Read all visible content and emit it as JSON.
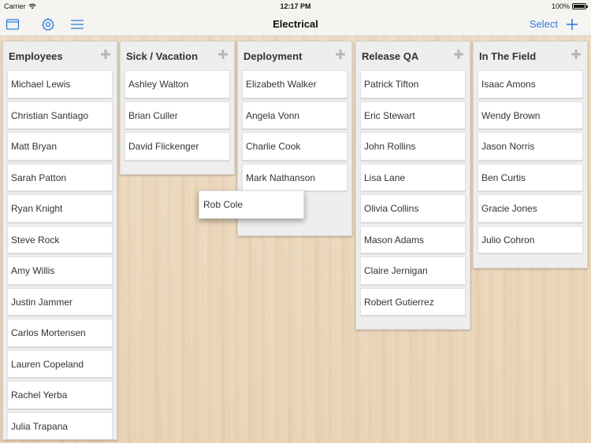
{
  "status_bar": {
    "carrier": "Carrier",
    "time": "12:17 PM",
    "battery": "100%"
  },
  "nav": {
    "title": "Electrical",
    "select_label": "Select",
    "left_icons": [
      "board-icon",
      "gear-icon",
      "list-icon"
    ],
    "right_icon": "plus-icon",
    "accent_color": "#2f7de1"
  },
  "columns": [
    {
      "title": "Employees",
      "cards": [
        "Michael Lewis",
        "Christian Santiago",
        "Matt Bryan",
        "Sarah Patton",
        "Ryan Knight",
        "Steve Rock",
        "Amy Willis",
        "Justin Jammer",
        "Carlos Mortensen",
        "Lauren Copeland",
        "Rachel Yerba",
        "Julia Trapana"
      ]
    },
    {
      "title": "Sick / Vacation",
      "cards": [
        "Ashley Walton",
        "Brian Culler",
        "David Flickenger"
      ]
    },
    {
      "title": "Deployment",
      "cards": [
        "Elizabeth Walker",
        "Angela Vonn",
        "Charlie Cook",
        "Mark Nathanson"
      ]
    },
    {
      "title": "Release QA",
      "cards": [
        "Patrick Tifton",
        "Eric Stewart",
        "John Rollins",
        "Lisa Lane",
        "Olivia Collins",
        "Mason Adams",
        "Claire Jernigan",
        "Robert Gutierrez"
      ]
    },
    {
      "title": "In The Field",
      "cards": [
        "Isaac Amons",
        "Wendy Brown",
        "Jason Norris",
        "Ben Curtis",
        "Gracie Jones",
        "Julio Cohron"
      ]
    }
  ],
  "dragging_card": "Rob Cole"
}
